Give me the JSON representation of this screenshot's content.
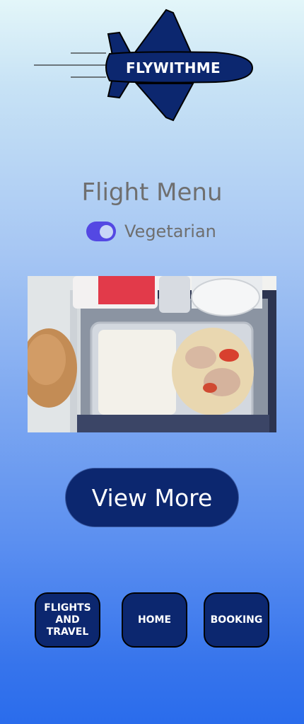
{
  "logo": {
    "text": "FLYWITHME",
    "color": "#0c276f"
  },
  "menu": {
    "title": "Flight Menu",
    "toggle": {
      "label": "Vegetarian",
      "state": "on",
      "color": "#5448e3"
    }
  },
  "meal_image": {
    "description_icon": "airline-meal-tray-photo"
  },
  "view_more_label": "View More",
  "nav": {
    "flights_label": "FLIGHTS AND TRAVEL",
    "home_label": "HOME",
    "booking_label": "BOOKING"
  },
  "colors": {
    "button_bg": "#0c276f",
    "title_text": "#6f6f6f"
  }
}
